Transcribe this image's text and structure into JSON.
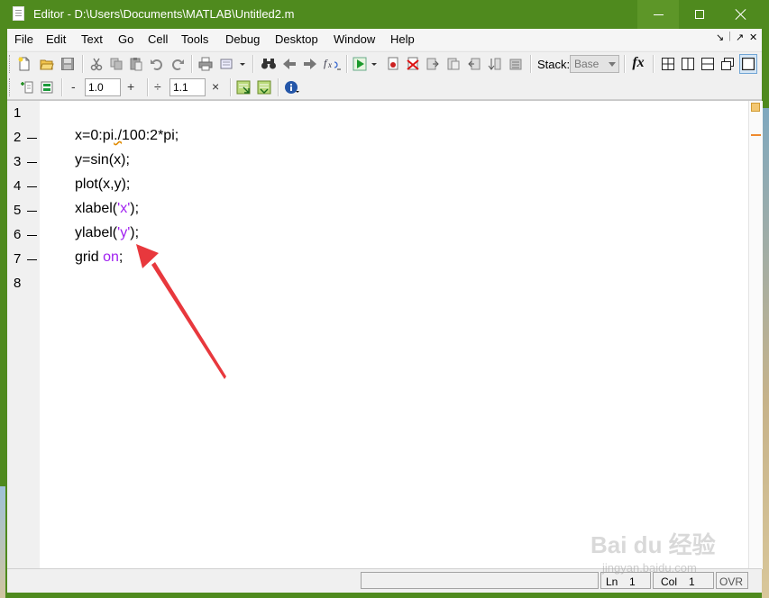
{
  "window": {
    "title": "Editor - D:\\Users\\Documents\\MATLAB\\Untitled2.m",
    "title_bar_color": "#4f8a1e"
  },
  "menu": {
    "items": [
      "File",
      "Edit",
      "Text",
      "Go",
      "Cell",
      "Tools",
      "Debug",
      "Desktop",
      "Window",
      "Help"
    ]
  },
  "toolbar": {
    "stack_label": "Stack:",
    "stack_value": "Base",
    "fx_label": "fx",
    "cell_minus": "-",
    "cell_plus": "+",
    "cell_value_1": "1.0",
    "cell_divide": "÷",
    "cell_value_2": "1.1",
    "cell_times": "×"
  },
  "editor": {
    "lines": [
      {
        "num": "1",
        "breakpoint": false,
        "code": ""
      },
      {
        "num": "2",
        "breakpoint": true,
        "code": "x=0:pi./100:2*pi;"
      },
      {
        "num": "3",
        "breakpoint": true,
        "code": "y=sin(x);"
      },
      {
        "num": "4",
        "breakpoint": true,
        "code": "plot(x,y);"
      },
      {
        "num": "5",
        "breakpoint": true,
        "code": "xlabel('x');"
      },
      {
        "num": "6",
        "breakpoint": true,
        "code": "ylabel('y');"
      },
      {
        "num": "7",
        "breakpoint": true,
        "code": "grid on;"
      },
      {
        "num": "8",
        "breakpoint": false,
        "code": ""
      }
    ],
    "string_color": "#a020f0",
    "keyword_color": "#a020f0"
  },
  "status": {
    "ln_label": "Ln",
    "ln_value": "1",
    "col_label": "Col",
    "col_value": "1",
    "ovr": "OVR"
  },
  "watermark": {
    "main": "Bai du 经验",
    "sub": "jingyan.baidu.com"
  },
  "annotation": {
    "arrow_color": "#e8383d"
  }
}
